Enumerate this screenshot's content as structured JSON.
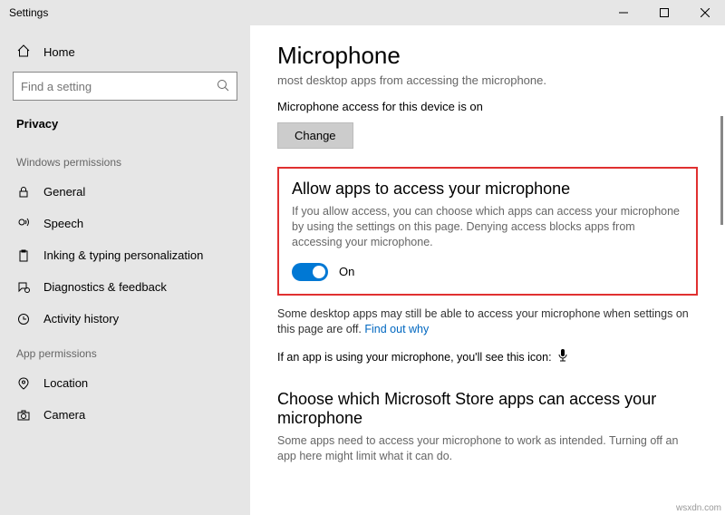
{
  "window": {
    "title": "Settings"
  },
  "sidebar": {
    "home": "Home",
    "search_placeholder": "Find a setting",
    "section": "Privacy",
    "group1": "Windows permissions",
    "items1": [
      "General",
      "Speech",
      "Inking & typing personalization",
      "Diagnostics & feedback",
      "Activity history"
    ],
    "group2": "App permissions",
    "items2": [
      "Location",
      "Camera"
    ]
  },
  "main": {
    "heading": "Microphone",
    "sub": "most desktop apps from accessing the microphone.",
    "device_status": "Microphone access for this device is on",
    "change_btn": "Change",
    "allow": {
      "title": "Allow apps to access your microphone",
      "desc": "If you allow access, you can choose which apps can access your microphone by using the settings on this page. Denying access blocks apps from accessing your microphone.",
      "state": "On"
    },
    "note1a": "Some desktop apps may still be able to access your microphone when settings on this page are off. ",
    "note1_link": "Find out why",
    "note2": "If an app is using your microphone, you'll see this icon:",
    "store": {
      "title": "Choose which Microsoft Store apps can access your microphone",
      "desc": "Some apps need to access your microphone to work as intended. Turning off an app here might limit what it can do."
    }
  },
  "watermark": "wsxdn.com"
}
